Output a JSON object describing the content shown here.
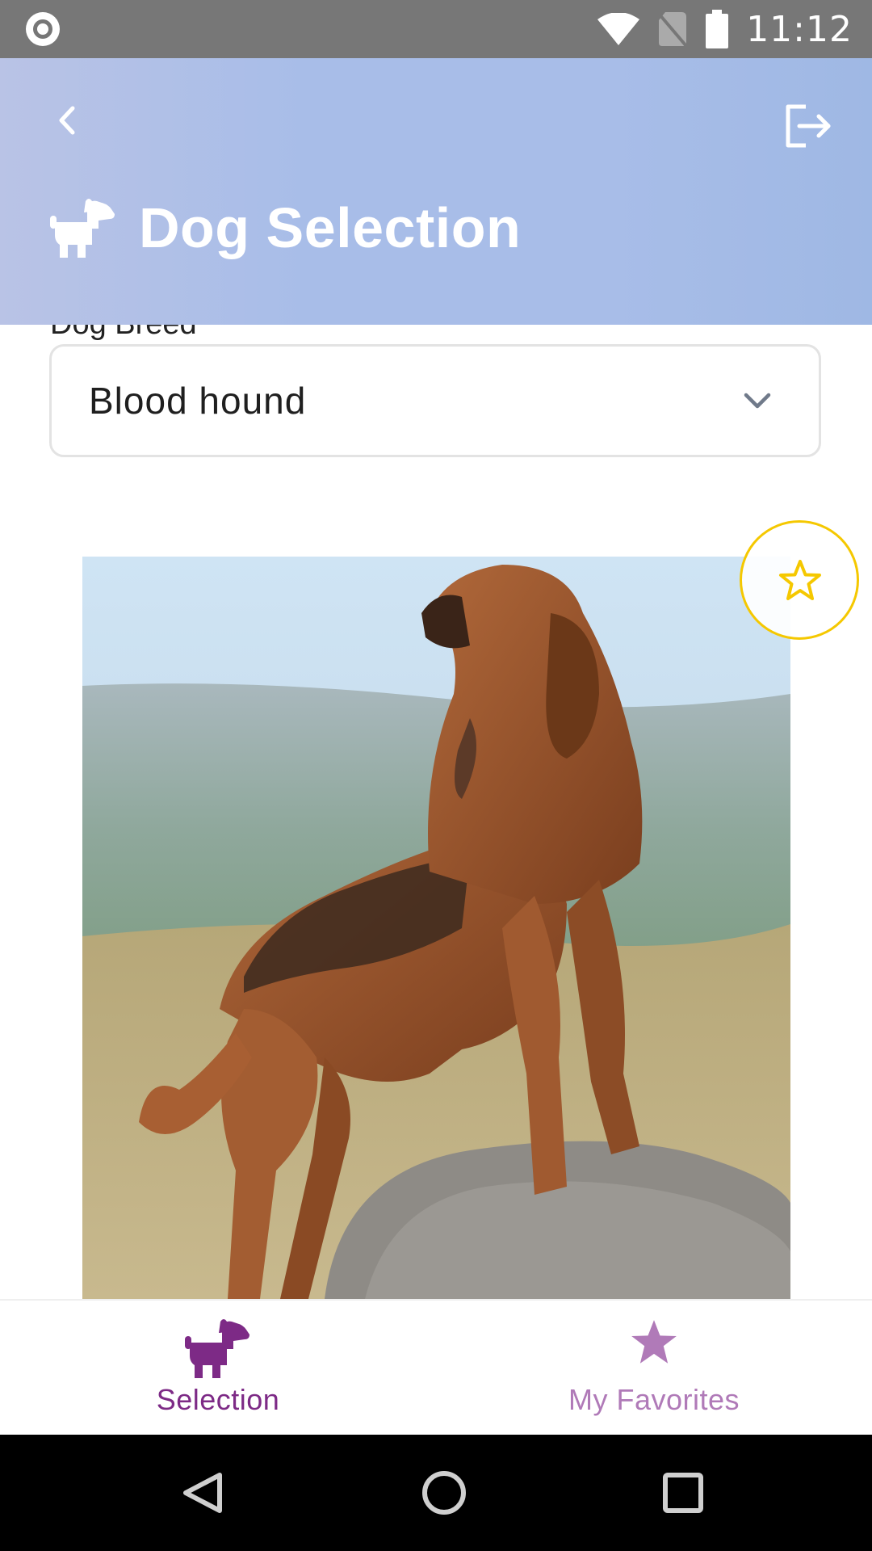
{
  "status_bar": {
    "time": "11:12",
    "icons": [
      "notification-dot-icon",
      "wifi-icon",
      "no-sim-icon",
      "battery-icon"
    ]
  },
  "header": {
    "title": "Dog Selection",
    "back_icon": "chevron-left-icon",
    "logout_icon": "logout-icon",
    "title_icon": "dog-icon",
    "gradient_colors": [
      "#b9c3e6",
      "#a8bde8",
      "#9fb8e4"
    ]
  },
  "breed_select": {
    "label": "Dog Breed",
    "value": "Blood hound"
  },
  "favorite": {
    "icon": "star-outline-icon",
    "accent_color": "#f5c800"
  },
  "bottom_nav": {
    "items": [
      {
        "label": "Selection",
        "icon": "dog-icon",
        "active": true,
        "color": "#7d2a86"
      },
      {
        "label": "My Favorites",
        "icon": "star-icon",
        "active": false,
        "color": "#b07ab8"
      }
    ]
  },
  "system_nav": {
    "icons": [
      "back-triangle-icon",
      "home-circle-icon",
      "recents-square-icon"
    ]
  }
}
